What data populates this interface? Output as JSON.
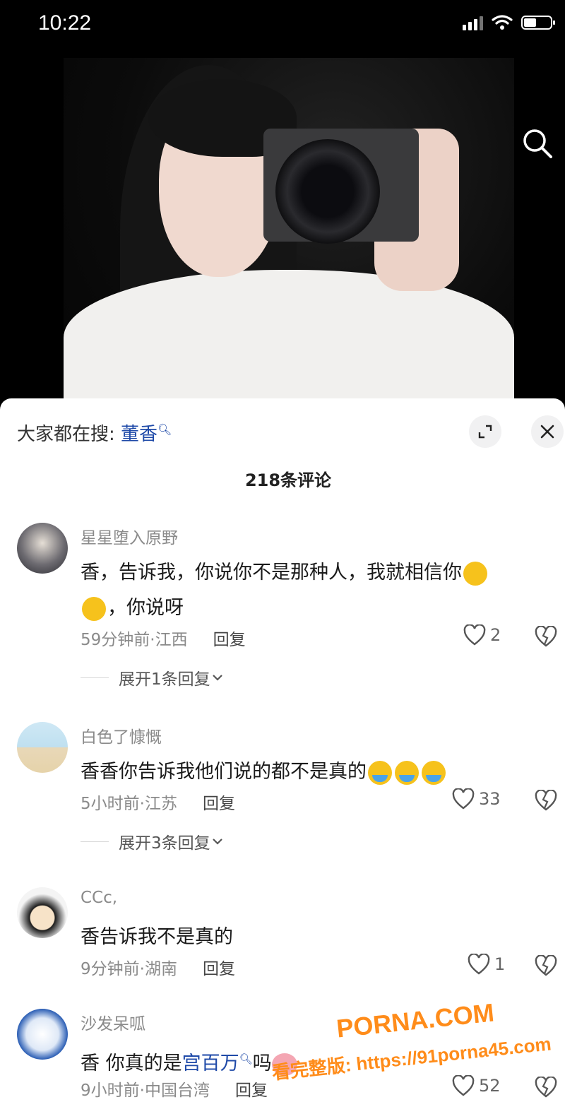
{
  "status_bar": {
    "time": "10:22"
  },
  "hot_search": {
    "prefix": "大家都在搜:",
    "term": "董香"
  },
  "comments_count": "218条评论",
  "comments": [
    {
      "username": "星星堕入原野",
      "text_before": "香，告诉我，你说你不是那种人，我就相信你",
      "text_after": "，你说呀",
      "time": "59分钟前·江西",
      "reply": "回复",
      "likes": "2",
      "expand": "展开1条回复"
    },
    {
      "username": "白色了慷慨",
      "text": "香香你告诉我他们说的都不是真的",
      "time": "5小时前·江苏",
      "reply": "回复",
      "likes": "33",
      "expand": "展开3条回复"
    },
    {
      "username": "CCc,",
      "text": "香告诉我不是真的",
      "time": "9分钟前·湖南",
      "reply": "回复",
      "likes": "1"
    },
    {
      "username": "沙发呆呱",
      "text_before": "香 你真的是",
      "link": "宫百万",
      "text_after": "吗",
      "time": "9小时前·中国台湾",
      "reply": "回复",
      "likes": "52"
    }
  ],
  "watermark": {
    "brand": "PORNA.COM",
    "url": "看完整版: https://91porna45.com"
  },
  "icons": [
    "search-icon",
    "expand-icon",
    "close-icon",
    "heart-icon",
    "broken-heart-icon",
    "chevron-down-icon"
  ]
}
